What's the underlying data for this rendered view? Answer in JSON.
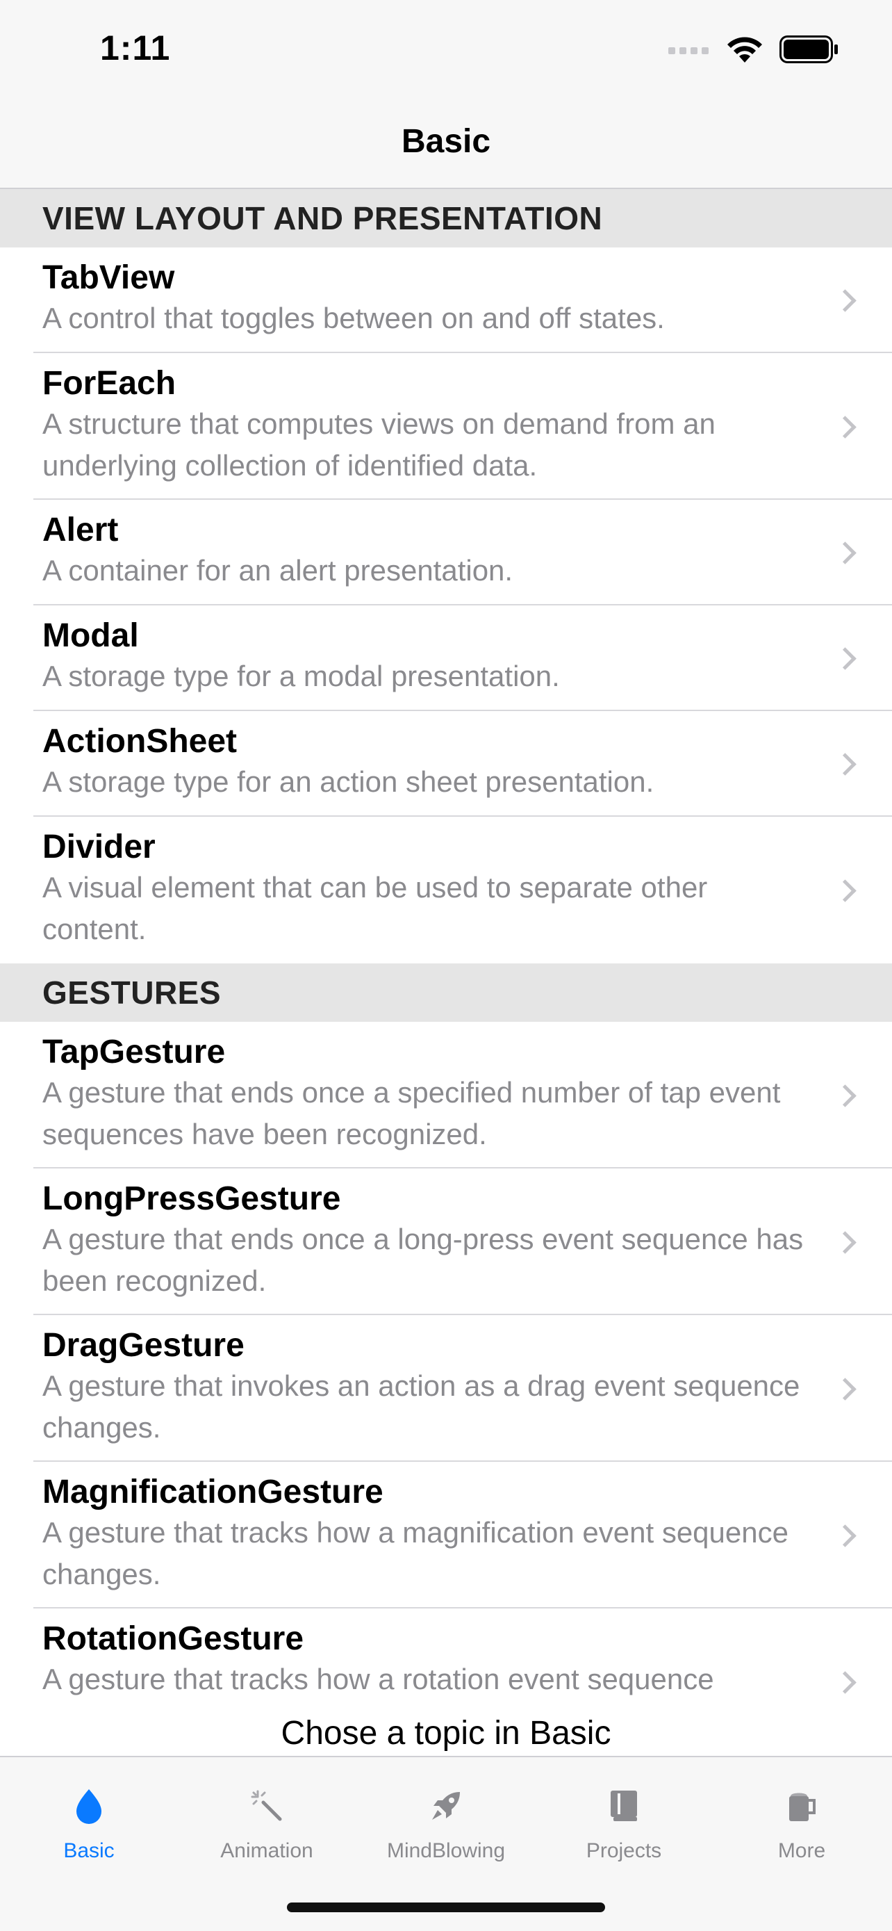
{
  "status_bar": {
    "time": "1:11"
  },
  "nav": {
    "title": "Basic"
  },
  "sections": [
    {
      "header": "VIEW LAYOUT AND PRESENTATION",
      "rows": [
        {
          "title": "TabView",
          "desc": "A control that toggles between on and off states."
        },
        {
          "title": "ForEach",
          "desc": "A structure that computes views on demand from an underlying collection of identified data."
        },
        {
          "title": "Alert",
          "desc": "A container for an alert presentation."
        },
        {
          "title": "Modal",
          "desc": "A storage type for a modal presentation."
        },
        {
          "title": "ActionSheet",
          "desc": "A storage type for an action sheet presentation."
        },
        {
          "title": "Divider",
          "desc": "A visual element that can be used to separate other content."
        }
      ]
    },
    {
      "header": "GESTURES",
      "rows": [
        {
          "title": "TapGesture",
          "desc": "A gesture that ends once a specified number of tap event sequences have been recognized."
        },
        {
          "title": "LongPressGesture",
          "desc": "A gesture that ends once a long-press event sequence has been recognized."
        },
        {
          "title": "DragGesture",
          "desc": "A gesture that invokes an action as a drag event sequence changes."
        },
        {
          "title": "MagnificationGesture",
          "desc": "A gesture that tracks how a magnification event sequence changes."
        },
        {
          "title": "RotationGesture",
          "desc": "A gesture that tracks how a rotation event sequence"
        }
      ]
    }
  ],
  "footer": {
    "text": "Chose a topic in Basic"
  },
  "tabs": [
    {
      "label": "Basic",
      "icon": "drop-icon",
      "active": true
    },
    {
      "label": "Animation",
      "icon": "magic-wand-icon",
      "active": false
    },
    {
      "label": "MindBlowing",
      "icon": "rocket-icon",
      "active": false
    },
    {
      "label": "Projects",
      "icon": "book-icon",
      "active": false
    },
    {
      "label": "More",
      "icon": "mug-icon",
      "active": false
    }
  ],
  "colors": {
    "accent": "#0a7aff",
    "inactive": "#8a8a8e",
    "section_bg": "#e5e5e5",
    "bar_bg": "#f7f7f7"
  }
}
